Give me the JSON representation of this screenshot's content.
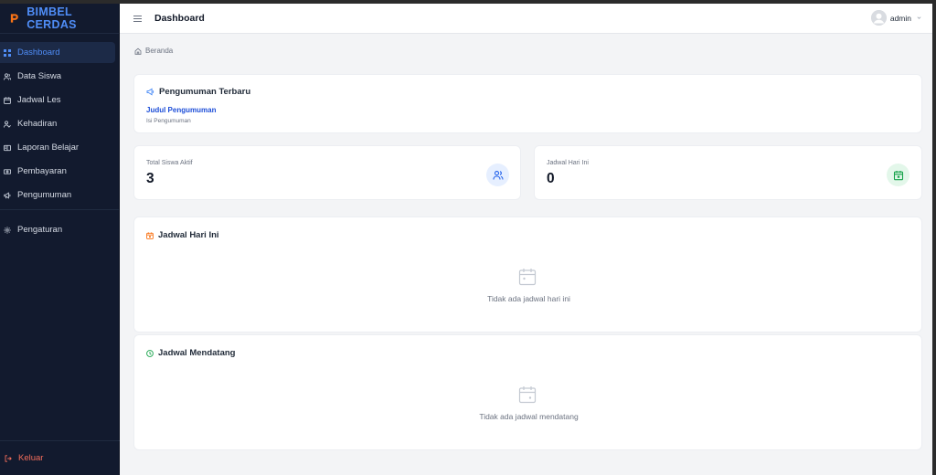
{
  "app": {
    "brand": "BIMBEL CERDAS",
    "accent": "#4f8df7"
  },
  "sidebar": {
    "items": [
      {
        "label": "Dashboard",
        "icon": "grid-icon",
        "active": true
      },
      {
        "label": "Data Siswa",
        "icon": "users-icon"
      },
      {
        "label": "Jadwal Les",
        "icon": "calendar-icon"
      },
      {
        "label": "Kehadiran",
        "icon": "user-check-icon"
      },
      {
        "label": "Laporan Belajar",
        "icon": "report-icon"
      },
      {
        "label": "Pembayaran",
        "icon": "money-icon"
      },
      {
        "label": "Pengumuman",
        "icon": "megaphone-icon"
      }
    ],
    "settings": {
      "label": "Pengaturan",
      "icon": "gear-icon"
    },
    "logout": {
      "label": "Keluar",
      "icon": "logout-icon",
      "color": "#f26d5b"
    }
  },
  "header": {
    "title": "Dashboard",
    "user": "admin"
  },
  "breadcrumb": {
    "label": "Beranda"
  },
  "announcement": {
    "title": "Pengumuman Terbaru",
    "headline": "Judul Pengumuman",
    "body": "Isi Pengumuman"
  },
  "stats": [
    {
      "label": "Total Siswa Aktif",
      "value": "3",
      "icon": "users-icon",
      "color": "#2563eb"
    },
    {
      "label": "Jadwal Hari Ini",
      "value": "0",
      "icon": "calendar-check-icon",
      "color": "#16a34a"
    }
  ],
  "schedule_today": {
    "title": "Jadwal Hari Ini",
    "empty": "Tidak ada jadwal hari ini",
    "icon_color": "#f97316"
  },
  "schedule_upcoming": {
    "title": "Jadwal Mendatang",
    "empty": "Tidak ada jadwal mendatang",
    "icon_color": "#16a34a"
  }
}
